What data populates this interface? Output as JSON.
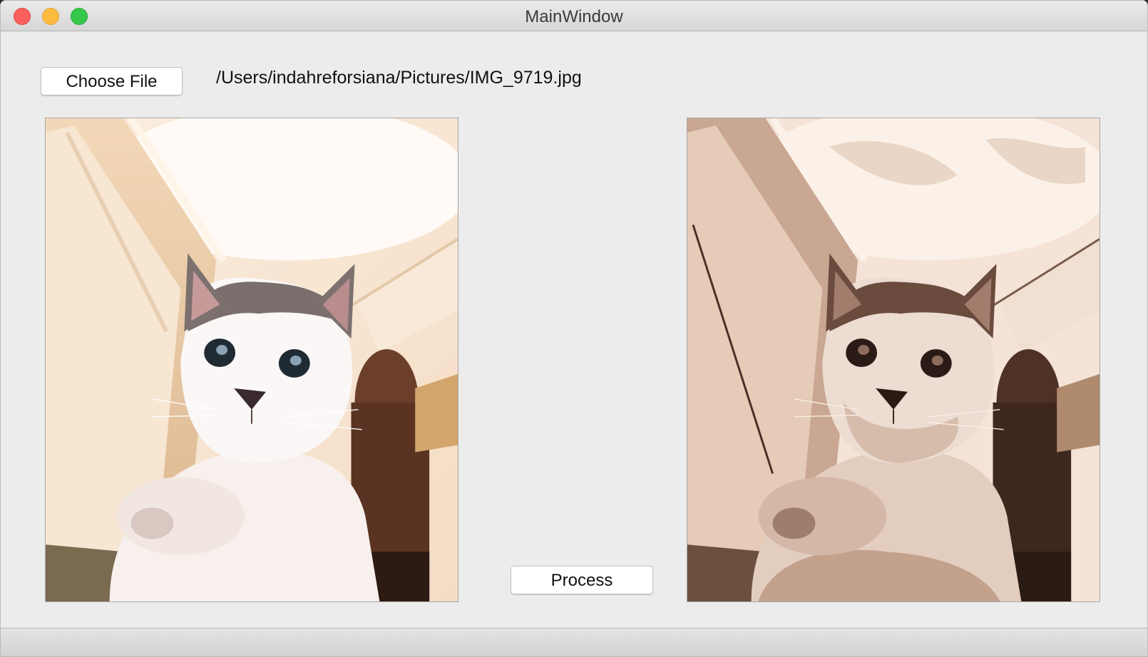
{
  "window": {
    "title": "MainWindow"
  },
  "toolbar": {
    "choose_file_label": "Choose File",
    "file_path": "/Users/indahreforsiana/Pictures/IMG_9719.jpg"
  },
  "images": {
    "original": {
      "description_icon": "cat-photo"
    },
    "processed": {
      "description_icon": "cat-photo-posterized"
    }
  },
  "actions": {
    "process_label": "Process"
  },
  "colors": {
    "close": "#fc605c",
    "minimize": "#fdbc40",
    "zoom": "#34c84a",
    "window_bg": "#ececec"
  }
}
